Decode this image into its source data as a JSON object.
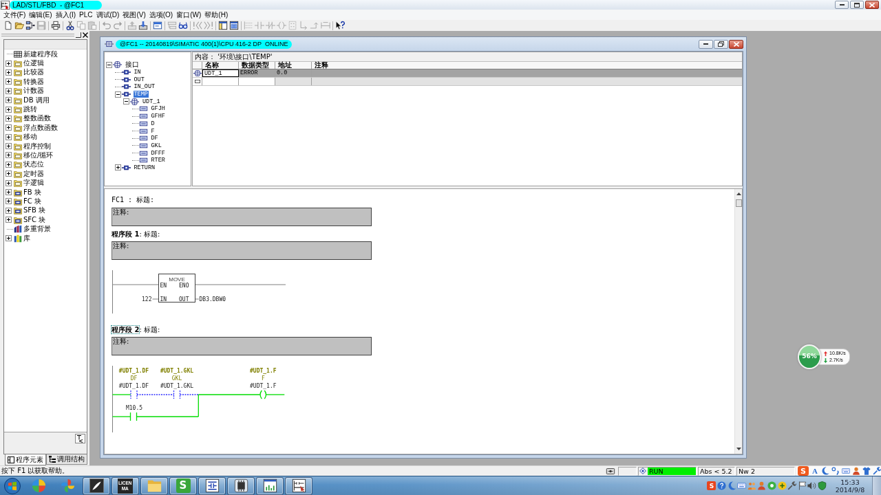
{
  "window": {
    "title": "LAD/STL/FBD  - @FC1",
    "highlighted": true
  },
  "menu": [
    "文件(F)",
    "编辑(E)",
    "插入(I)",
    "PLC",
    "调试(D)",
    "视图(V)",
    "选项(O)",
    "窗口(W)",
    "帮助(H)"
  ],
  "toolbar": [
    [
      {
        "kind": "new",
        "disabled": false
      },
      {
        "kind": "open",
        "disabled": false
      },
      {
        "kind": "nodes",
        "disabled": false
      },
      {
        "kind": "save",
        "disabled": true
      }
    ],
    [
      {
        "kind": "print",
        "disabled": false
      }
    ],
    [
      {
        "kind": "cut",
        "disabled": false
      },
      {
        "kind": "copy",
        "disabled": true
      },
      {
        "kind": "paste",
        "disabled": true
      }
    ],
    [
      {
        "kind": "undo",
        "disabled": true
      },
      {
        "kind": "redo",
        "disabled": true
      }
    ],
    [
      {
        "kind": "upload",
        "disabled": true
      },
      {
        "kind": "download",
        "disabled": false
      }
    ],
    [
      {
        "kind": "window",
        "disabled": false
      }
    ],
    [
      {
        "kind": "block",
        "disabled": true
      },
      {
        "kind": "glasses",
        "disabled": false
      }
    ],
    [
      {
        "kind": "first",
        "disabled": true
      },
      {
        "kind": "last",
        "disabled": true
      }
    ],
    [
      {
        "kind": "overview",
        "disabled": false
      },
      {
        "kind": "details",
        "disabled": false
      }
    ],
    [
      {
        "kind": "new-network",
        "disabled": true
      },
      {
        "kind": "contact",
        "disabled": true
      },
      {
        "kind": "nc-contact",
        "disabled": true
      },
      {
        "kind": "coil",
        "disabled": true
      },
      {
        "kind": "box",
        "disabled": true
      },
      {
        "kind": "branch-open",
        "disabled": true
      },
      {
        "kind": "branch-close",
        "disabled": true
      },
      {
        "kind": "connection",
        "disabled": true
      }
    ],
    [
      {
        "kind": "help",
        "disabled": false
      }
    ]
  ],
  "catalog_panel": {
    "items": [
      {
        "label": "新建程序段",
        "kind": "network"
      },
      {
        "label": "位逻辑",
        "kind": "folder",
        "expanded": false
      },
      {
        "label": "比较器",
        "kind": "folder",
        "expanded": false
      },
      {
        "label": "转换器",
        "kind": "folder",
        "expanded": false
      },
      {
        "label": "计数器",
        "kind": "folder",
        "expanded": false
      },
      {
        "label": "DB 调用",
        "kind": "folder",
        "expanded": false
      },
      {
        "label": "跳转",
        "kind": "folder",
        "expanded": false
      },
      {
        "label": "整数函数",
        "kind": "folder",
        "expanded": false
      },
      {
        "label": "浮点数函数",
        "kind": "folder",
        "expanded": false
      },
      {
        "label": "移动",
        "kind": "folder",
        "expanded": false
      },
      {
        "label": "程序控制",
        "kind": "folder",
        "expanded": false
      },
      {
        "label": "移位/循环",
        "kind": "folder",
        "expanded": false
      },
      {
        "label": "状态位",
        "kind": "folder",
        "expanded": false
      },
      {
        "label": "定时器",
        "kind": "folder",
        "expanded": false
      },
      {
        "label": "字逻辑",
        "kind": "folder",
        "expanded": false
      },
      {
        "label": "FB 块",
        "kind": "block",
        "expanded": false
      },
      {
        "label": "FC 块",
        "kind": "block",
        "expanded": false
      },
      {
        "label": "SFB 块",
        "kind": "block",
        "expanded": false
      },
      {
        "label": "SFC 块",
        "kind": "block",
        "expanded": false
      },
      {
        "label": "多重背景",
        "kind": "multi-instance"
      },
      {
        "label": "库",
        "kind": "library",
        "expanded": false
      }
    ],
    "tabs": [
      {
        "label": "程序元素",
        "kind": "elements",
        "selected": true
      },
      {
        "label": "调用结构",
        "kind": "calls",
        "selected": false
      }
    ]
  },
  "editor_window": {
    "title": "@FC1 -- 20140819\\SIMATIC 400(1)\\CPU 416-2 DP  ONLINE",
    "highlighted": true,
    "interface_tree": [
      {
        "label": "接口",
        "kind": "root",
        "expanded": true,
        "selected": false,
        "children": [
          {
            "label": "IN",
            "kind": "section",
            "selected": false
          },
          {
            "label": "OUT",
            "kind": "section",
            "selected": false
          },
          {
            "label": "IN_OUT",
            "kind": "section",
            "selected": false
          },
          {
            "label": "TEMP",
            "kind": "section",
            "expanded": true,
            "selected": true,
            "children": [
              {
                "label": "UDT_1",
                "kind": "struct",
                "expanded": true,
                "selected": false,
                "children": [
                  {
                    "label": "GFJH",
                    "kind": "element",
                    "selected": false
                  },
                  {
                    "label": "GFHF",
                    "kind": "element",
                    "selected": false
                  },
                  {
                    "label": "D",
                    "kind": "element",
                    "selected": false
                  },
                  {
                    "label": "F",
                    "kind": "element",
                    "selected": false
                  },
                  {
                    "label": "DF",
                    "kind": "element",
                    "selected": false
                  },
                  {
                    "label": "GKL",
                    "kind": "element",
                    "selected": false
                  },
                  {
                    "label": "DFFF",
                    "kind": "element",
                    "selected": false
                  },
                  {
                    "label": "RTER",
                    "kind": "element",
                    "selected": false
                  }
                ]
              }
            ]
          },
          {
            "label": "RETURN",
            "kind": "section",
            "expanded": false,
            "selected": false
          }
        ]
      }
    ],
    "declaration_table": {
      "path": "内容： '环境\\接口\\TEMP'",
      "columns": [
        "名称",
        "数据类型",
        "地址",
        "注释"
      ],
      "rows": [
        {
          "name": "UDT_1",
          "data_type": "ERROR",
          "address": "0.0",
          "selected": true
        }
      ]
    },
    "block_title": "FC1 : 标题:",
    "block_comment": "注释:",
    "networks": [
      {
        "kind": "move",
        "label": "程序段 1",
        "title": ": 标题:",
        "selected": false,
        "comment": "注释:",
        "block": {
          "name": "MOVE",
          "en": "EN",
          "eno": "ENO",
          "in": "IN",
          "out": "OUT"
        },
        "input": "122",
        "output": "DB3.DBW0"
      },
      {
        "kind": "ladder",
        "label": "程序段 2",
        "title": ": 标题:",
        "selected": true,
        "comment": "注释:",
        "rung": [
          {
            "kind": "contact",
            "symbol": "#UDT_1.DF",
            "comment": "DF",
            "operand": "#UDT_1.DF",
            "powered": false
          },
          {
            "kind": "contact",
            "symbol": "#UDT_1.GKL",
            "comment": "GKL",
            "operand": "#UDT_1.GKL",
            "powered": false
          },
          {
            "kind": "coil",
            "symbol": "#UDT_1.F",
            "comment": "F",
            "operand": "#UDT_1.F",
            "powered": true
          }
        ],
        "branch": [
          {
            "kind": "contact",
            "operand": "M10.5",
            "powered": true
          }
        ]
      }
    ]
  },
  "status_bar": {
    "message": "按下 F1 以获取帮助。",
    "cpu_mode": "RUN",
    "position": "Abs < 5.2",
    "network": "Nw 2"
  },
  "ime_bar": [
    {
      "kind": "logo",
      "glyph": "S"
    },
    {
      "kind": "letter",
      "glyph": "A"
    },
    {
      "kind": "moon"
    },
    {
      "kind": "punctuation"
    },
    {
      "kind": "keyboard"
    },
    {
      "kind": "person"
    },
    {
      "kind": "shirt"
    },
    {
      "kind": "wrench"
    }
  ],
  "taskbar": {
    "items": [
      {
        "kind": "start"
      },
      {
        "kind": "ball",
        "running": false
      },
      {
        "kind": "pinwheel",
        "running": false
      },
      {
        "kind": "pen",
        "running": true
      },
      {
        "kind": "license",
        "lines": [
          "LICEN",
          "MA"
        ],
        "running": true
      },
      {
        "kind": "folder",
        "running": true
      },
      {
        "kind": "tile",
        "glyph": "S",
        "running": true
      },
      {
        "kind": "plc",
        "running": true
      },
      {
        "kind": "chip",
        "running": true
      },
      {
        "kind": "meter",
        "running": true
      },
      {
        "kind": "ladder",
        "running": true
      }
    ],
    "tray": [
      {
        "kind": "tile",
        "glyph": "S"
      },
      {
        "kind": "help"
      },
      {
        "kind": "moon"
      },
      {
        "kind": "keyboard"
      },
      {
        "kind": "users"
      },
      {
        "kind": "person"
      },
      {
        "kind": "green"
      },
      {
        "kind": "plus"
      },
      {
        "kind": "tools"
      },
      {
        "kind": "flag"
      },
      {
        "kind": "speaker"
      },
      {
        "kind": "shield"
      }
    ],
    "clock": {
      "time": "15:33",
      "date": "2014/9/8"
    }
  },
  "network_monitor": {
    "percent": "56%",
    "level": 0.56,
    "upload": "10.8K/s",
    "download": "2.7K/s"
  }
}
